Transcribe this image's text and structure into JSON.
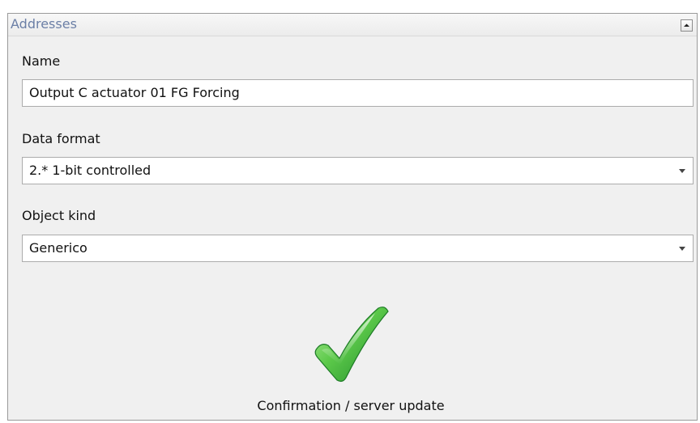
{
  "panel": {
    "title": "Addresses",
    "collapse_icon": "chevron-up-icon"
  },
  "name_field": {
    "label": "Name",
    "value": "Output C actuator 01 FG Forcing"
  },
  "data_format_field": {
    "label": "Data format",
    "value": "2.* 1-bit controlled"
  },
  "object_kind_field": {
    "label": "Object kind",
    "value": "Generico"
  },
  "confirm": {
    "icon": "checkmark-icon",
    "label": "Confirmation / server update",
    "icon_color": "#3cb043"
  },
  "colors": {
    "title": "#6b7fa6",
    "panel_background": "#f0f0f0"
  }
}
